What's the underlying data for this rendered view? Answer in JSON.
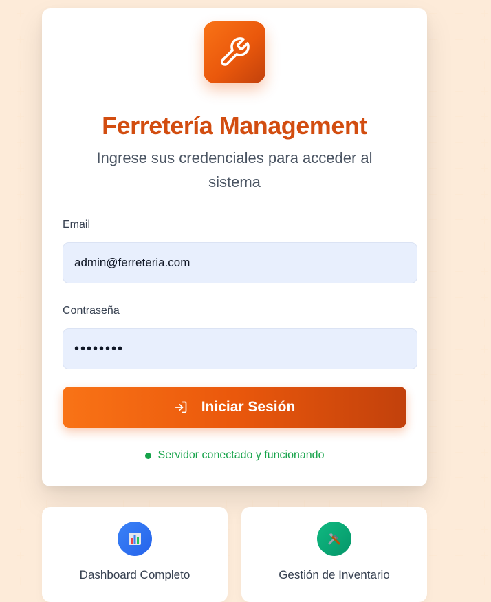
{
  "app": {
    "title": "Ferretería Management",
    "subtitle": "Ingrese sus credenciales para acceder al sistema"
  },
  "form": {
    "email_label": "Email",
    "email_value": "admin@ferreteria.com",
    "password_label": "Contraseña",
    "password_value": "••••••••",
    "submit_label": "Iniciar Sesión"
  },
  "status": {
    "text": "Servidor conectado y funcionando",
    "color": "#16a34a"
  },
  "features": [
    {
      "label": "Dashboard Completo",
      "icon": "bar-chart-icon",
      "color": "#3b82f6"
    },
    {
      "label": "Gestión de Inventario",
      "icon": "tools-icon",
      "color": "#10b981"
    }
  ],
  "colors": {
    "accent": "#ea580c",
    "accent_dark": "#c2410c",
    "input_bg": "#e8effd"
  },
  "icons": {
    "logo": "wrench-icon",
    "submit": "login-icon"
  }
}
